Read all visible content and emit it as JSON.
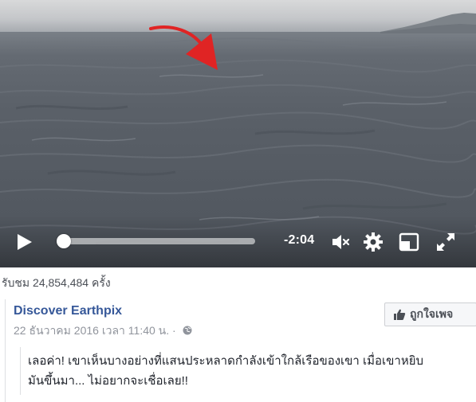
{
  "video": {
    "time_remaining": "-2:04",
    "progress": 0.02
  },
  "meta": {
    "views": "รับชม 24,854,484 ครั้ง"
  },
  "post": {
    "page_name": "Discover Earthpix",
    "date": "22 ธันวาคม 2016 เวลา 11:40 น. ·",
    "like_page_label": "ถูกใจเพจ",
    "caption_line1": "เลอค่า! เขาเห็นบางอย่างที่แสนประหลาดกำลังเข้าใกล้เรือของเขา เมื่อเขาหยิบ",
    "caption_line2": "มันขึ้นมา... ไม่อยากจะเชื่อเลย!!"
  },
  "colors": {
    "link_blue": "#365899",
    "arrow_red": "#e02424",
    "meta_gray": "#90949c"
  },
  "icons": [
    "play-icon",
    "volume-mute-icon",
    "settings-gear-icon",
    "pip-icon",
    "fullscreen-icon",
    "globe-icon",
    "thumbs-up-icon",
    "red-arrow-annotation"
  ]
}
